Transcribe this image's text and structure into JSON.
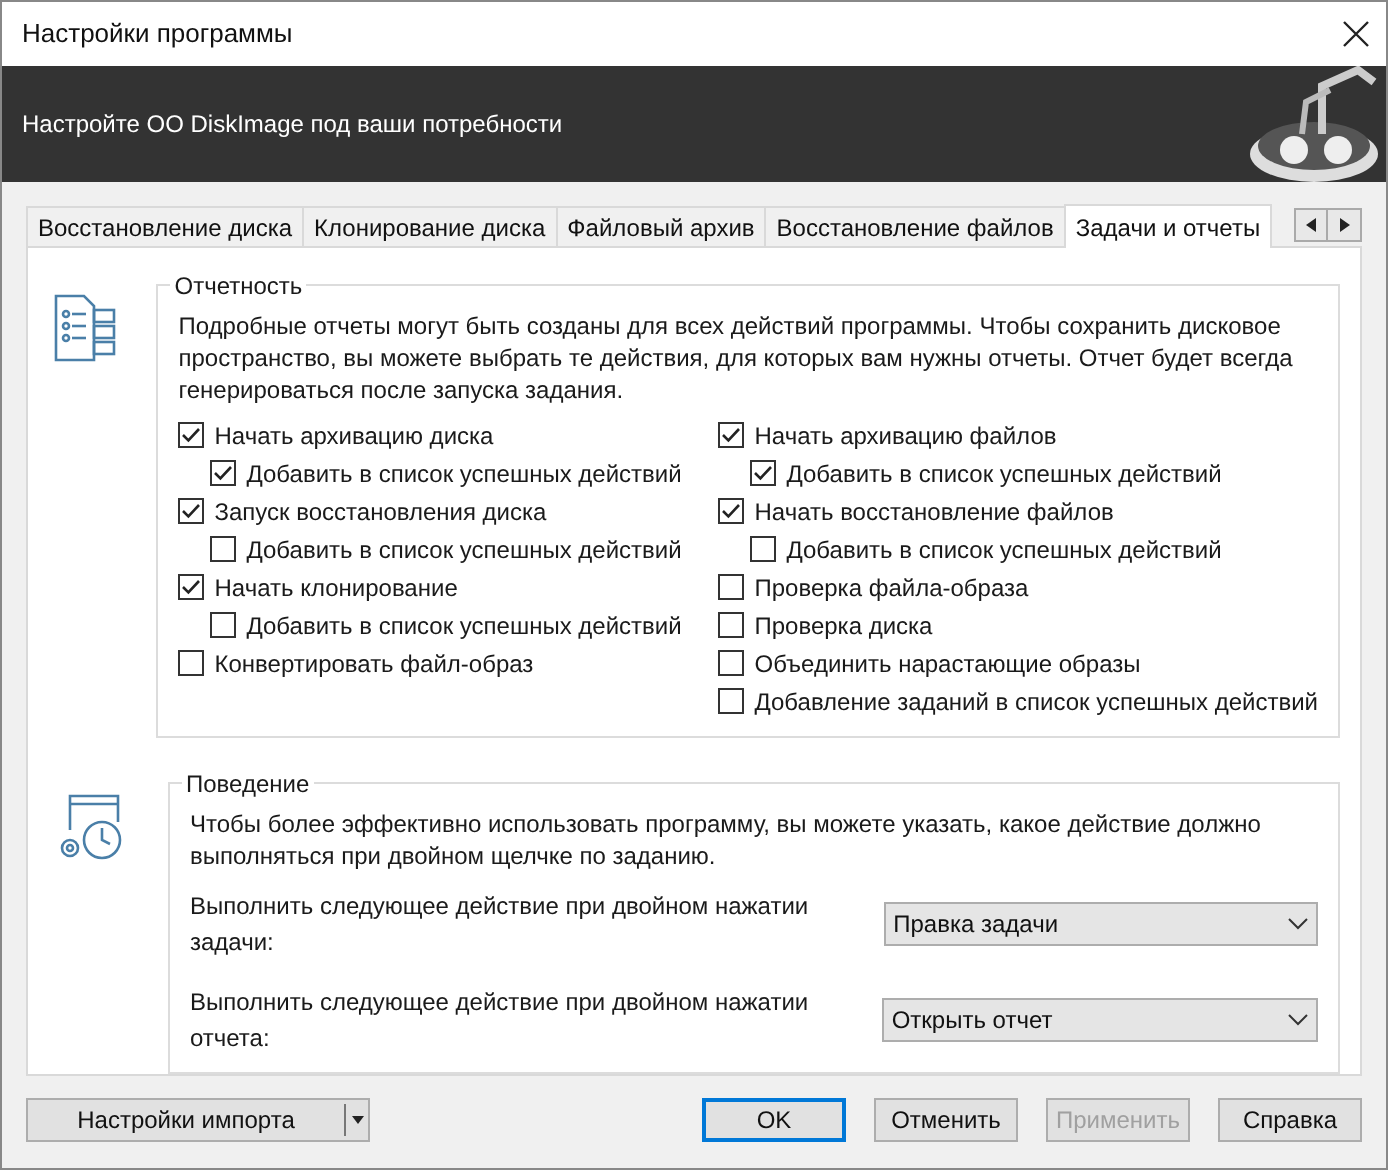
{
  "window": {
    "title": "Настройки программы"
  },
  "header": {
    "subtitle": "Настройте OO DiskImage под ваши потребности"
  },
  "tabs": [
    {
      "label": "Восстановление диска",
      "selected": false
    },
    {
      "label": "Клонирование диска",
      "selected": false
    },
    {
      "label": "Файловый архив",
      "selected": false
    },
    {
      "label": "Восстановление файлов",
      "selected": false
    },
    {
      "label": "Задачи и отчеты",
      "selected": true
    }
  ],
  "reporting": {
    "title": "Отчетность",
    "description": "Подробные отчеты могут быть созданы для всех действий программы. Чтобы сохранить дисковое пространство, вы можете выбрать те действия, для которых вам нужны отчеты. Отчет будет всегда генерироваться после запуска задания.",
    "columns": [
      [
        {
          "label": "Начать архивацию диска",
          "checked": true,
          "children": [
            {
              "label": "Добавить в список успешных действий",
              "checked": true
            }
          ]
        },
        {
          "label": "Запуск восстановления диска",
          "checked": true,
          "children": [
            {
              "label": "Добавить в список успешных действий",
              "checked": false
            }
          ]
        },
        {
          "label": "Начать клонирование",
          "checked": true,
          "children": [
            {
              "label": "Добавить в список успешных действий",
              "checked": false
            }
          ]
        },
        {
          "label": "Конвертировать файл-образ",
          "checked": false
        }
      ],
      [
        {
          "label": "Начать архивацию файлов",
          "checked": true,
          "children": [
            {
              "label": "Добавить в список успешных действий",
              "checked": true
            }
          ]
        },
        {
          "label": "Начать восстановление файлов",
          "checked": true,
          "children": [
            {
              "label": "Добавить в список успешных действий",
              "checked": false
            }
          ]
        },
        {
          "label": "Проверка файла-образа",
          "checked": false
        },
        {
          "label": "Проверка диска",
          "checked": false
        },
        {
          "label": "Объединить нарастающие образы",
          "checked": false
        },
        {
          "label": "Добавление заданий в список успешных действий",
          "checked": false
        }
      ]
    ]
  },
  "behavior": {
    "title": "Поведение",
    "description": "Чтобы более эффективно использовать программу, вы можете указать, какое действие должно выполняться при двойном щелчке по заданию.",
    "settings": [
      {
        "label": "Выполнить следующее действие при двойном нажатии задачи:",
        "value": "Правка задачи"
      },
      {
        "label": "Выполнить следующее действие при двойном нажатии отчета:",
        "value": "Открыть отчет"
      }
    ]
  },
  "footer": {
    "import_button": "Настройки импорта",
    "buttons": [
      {
        "label": "OK",
        "kind": "default",
        "disabled": false
      },
      {
        "label": "Отменить",
        "kind": "normal",
        "disabled": false
      },
      {
        "label": "Применить",
        "kind": "normal",
        "disabled": true
      },
      {
        "label": "Справка",
        "kind": "normal",
        "disabled": false
      }
    ]
  }
}
